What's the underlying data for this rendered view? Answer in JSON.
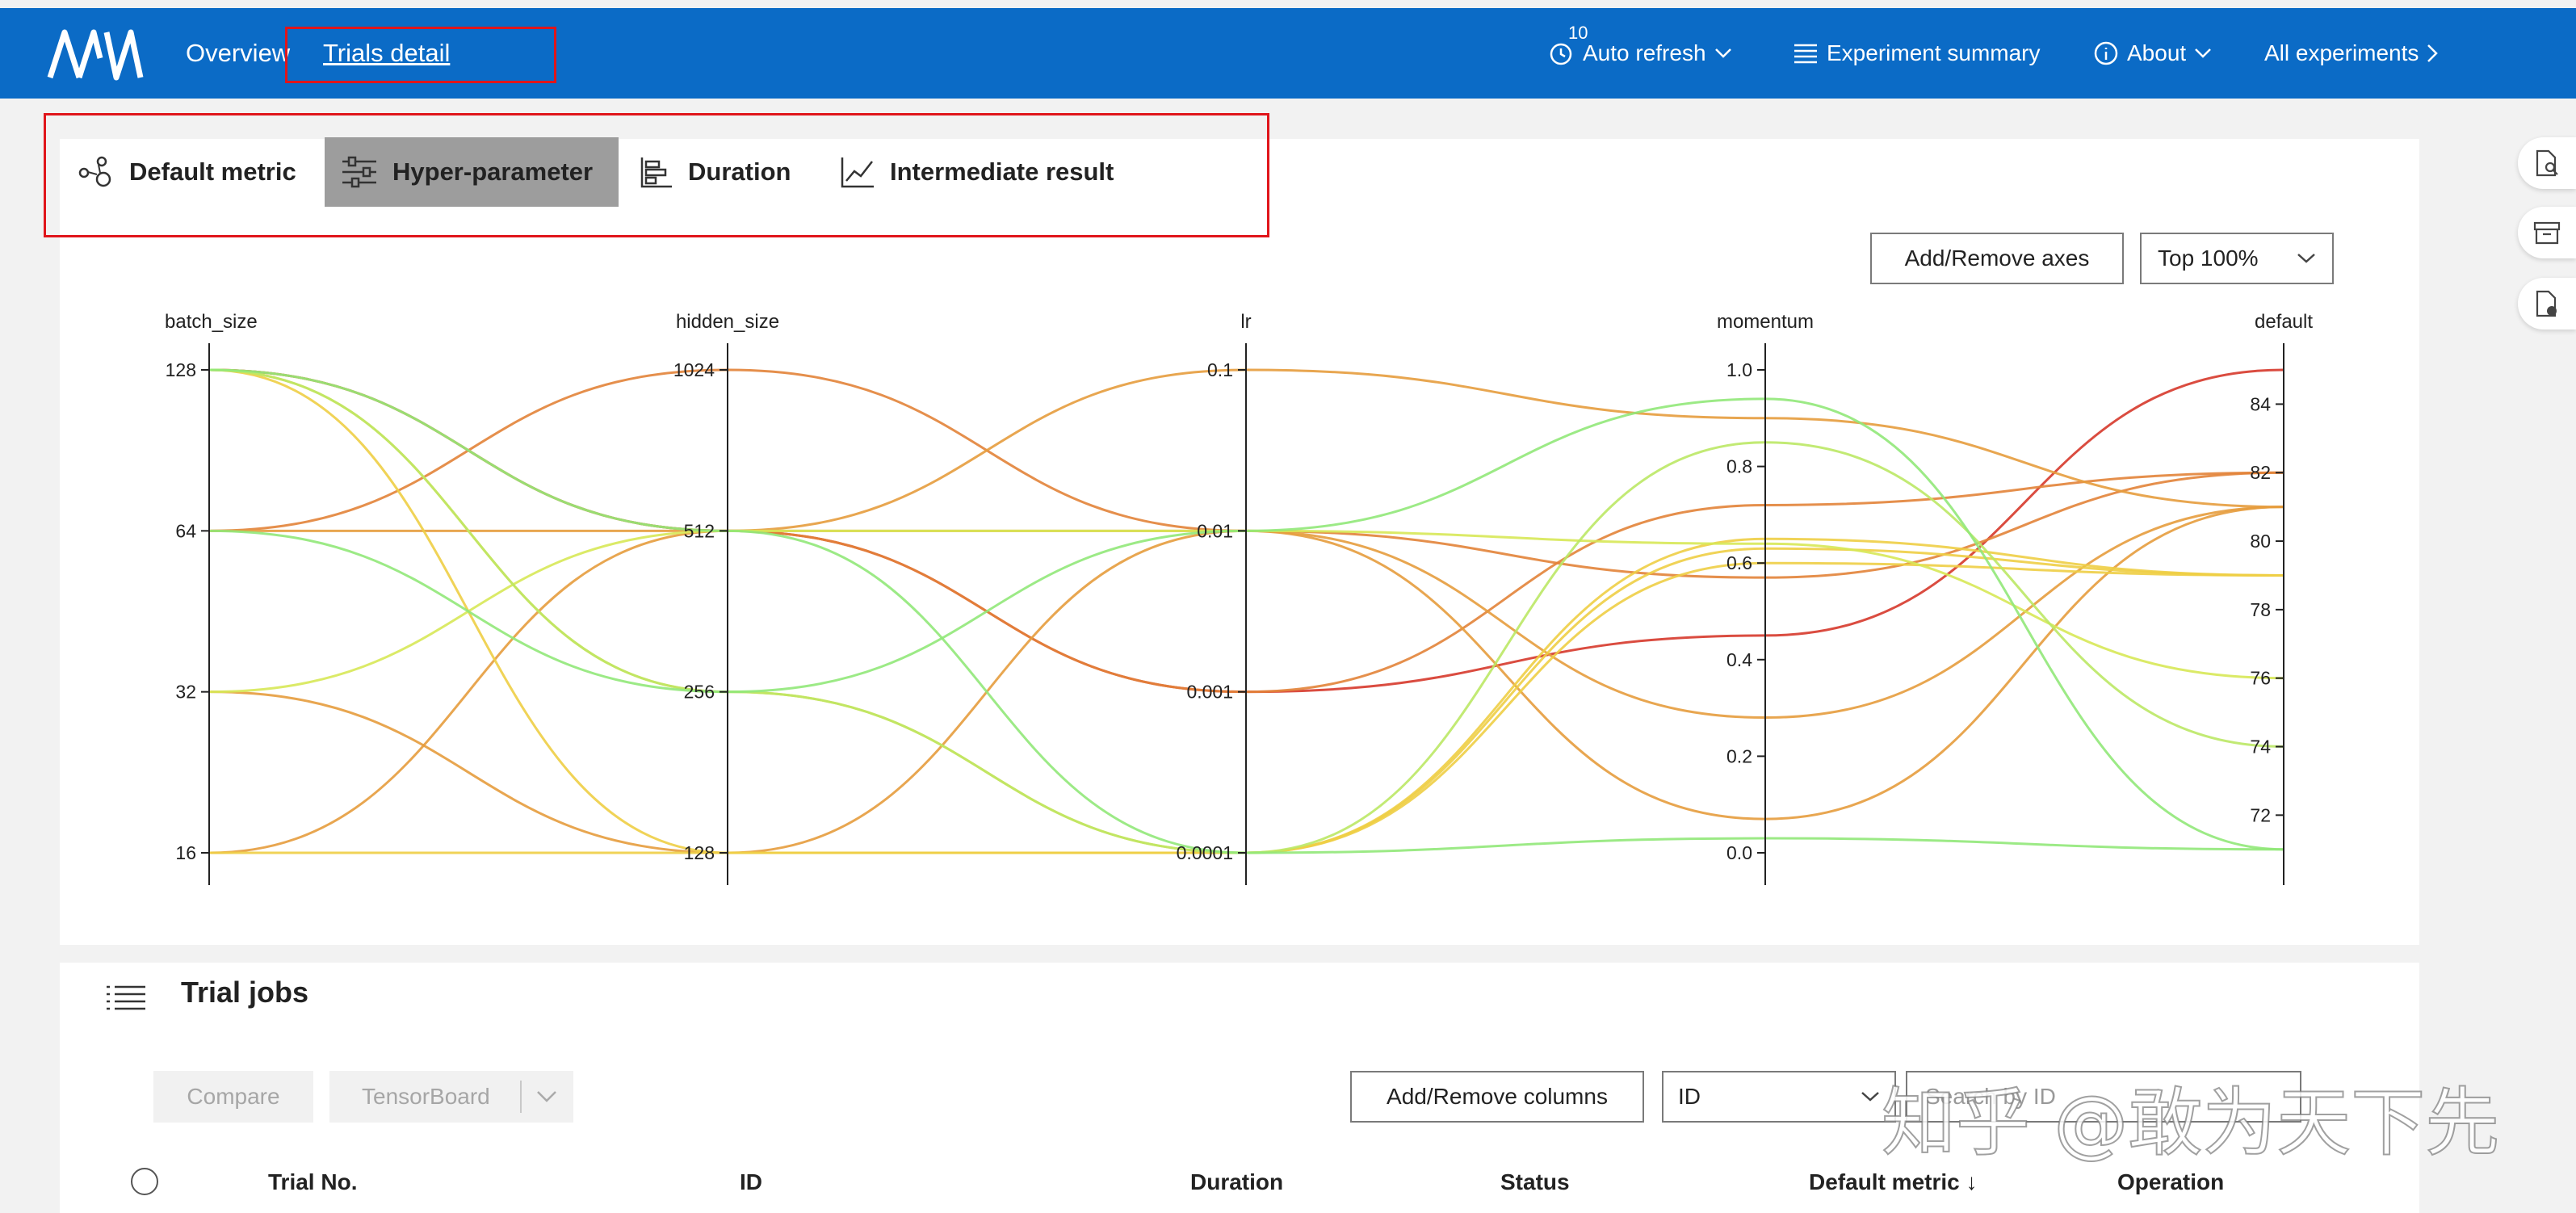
{
  "header": {
    "logo_icon": "nni-logo-icon",
    "nav": [
      {
        "label": "Overview"
      },
      {
        "label": "Trials detail"
      }
    ],
    "auto_refresh": {
      "label": "Auto refresh",
      "count": "10"
    },
    "experiment_summary": "Experiment summary",
    "about": "About",
    "all_experiments": "All experiments"
  },
  "tabs": [
    {
      "label": "Default metric",
      "icon": "scatter-icon"
    },
    {
      "label": "Hyper-parameter",
      "icon": "sliders-icon",
      "selected": true
    },
    {
      "label": "Duration",
      "icon": "bar-list-icon"
    },
    {
      "label": "Intermediate result",
      "icon": "line-chart-icon"
    }
  ],
  "controls": {
    "add_remove_axes": "Add/Remove axes",
    "top_select": "Top 100%"
  },
  "chart_data": {
    "type": "parallel-coordinates",
    "axes": [
      {
        "name": "batch_size",
        "ticks": [
          "16",
          "32",
          "64",
          "128"
        ],
        "scale": "log2"
      },
      {
        "name": "hidden_size",
        "ticks": [
          "128",
          "256",
          "512",
          "1024"
        ],
        "scale": "log2"
      },
      {
        "name": "lr",
        "ticks": [
          "0.0001",
          "0.001",
          "0.01",
          "0.1"
        ],
        "scale": "log10"
      },
      {
        "name": "momentum",
        "ticks": [
          "0.0",
          "0.2",
          "0.4",
          "0.6",
          "0.8",
          "1.0"
        ],
        "range": [
          0,
          1
        ],
        "scale": "linear"
      },
      {
        "name": "default",
        "ticks": [
          "72",
          "74",
          "76",
          "78",
          "80",
          "82",
          "84"
        ],
        "range": [
          70.9,
          85.0
        ],
        "scale": "linear"
      }
    ],
    "color_scale": {
      "low": "#90e87a",
      "mid": "#f2e84a",
      "high": "#d6392b"
    },
    "trials": [
      {
        "batch_size": 128,
        "hidden_size": 512,
        "lr": 0.001,
        "momentum": 0.45,
        "default": 85.0
      },
      {
        "batch_size": 128,
        "hidden_size": 512,
        "lr": 0.001,
        "momentum": 0.72,
        "default": 82.0
      },
      {
        "batch_size": 64,
        "hidden_size": 1024,
        "lr": 0.01,
        "momentum": 0.57,
        "default": 82.0
      },
      {
        "batch_size": 64,
        "hidden_size": 512,
        "lr": 0.1,
        "momentum": 0.9,
        "default": 81.0
      },
      {
        "batch_size": 16,
        "hidden_size": 512,
        "lr": 0.01,
        "momentum": 0.28,
        "default": 81.0
      },
      {
        "batch_size": 32,
        "hidden_size": 128,
        "lr": 0.01,
        "momentum": 0.07,
        "default": 81.0
      },
      {
        "batch_size": 128,
        "hidden_size": 128,
        "lr": 0.0001,
        "momentum": 0.65,
        "default": 79.0
      },
      {
        "batch_size": 16,
        "hidden_size": 128,
        "lr": 0.0001,
        "momentum": 0.63,
        "default": 79.0
      },
      {
        "batch_size": 128,
        "hidden_size": 256,
        "lr": 0.0001,
        "momentum": 0.6,
        "default": 79.0
      },
      {
        "batch_size": 32,
        "hidden_size": 512,
        "lr": 0.01,
        "momentum": 0.64,
        "default": 76.0
      },
      {
        "batch_size": 128,
        "hidden_size": 256,
        "lr": 0.0001,
        "momentum": 0.85,
        "default": 74.0
      },
      {
        "batch_size": 64,
        "hidden_size": 256,
        "lr": 0.01,
        "momentum": 0.94,
        "default": 71.0
      },
      {
        "batch_size": 128,
        "hidden_size": 512,
        "lr": 0.0001,
        "momentum": 0.03,
        "default": 71.0
      }
    ]
  },
  "side_icons": [
    "document-search-icon",
    "archive-icon",
    "document-status-icon"
  ],
  "trial_jobs": {
    "title": "Trial jobs",
    "compare": "Compare",
    "tensorboard": "TensorBoard",
    "add_remove_columns": "Add/Remove columns",
    "search_field": "ID",
    "search_placeholder": "Search by ID",
    "columns": [
      "Trial No.",
      "ID",
      "Duration",
      "Status",
      "Default metric ↓",
      "Operation"
    ]
  },
  "watermark": "知乎 @敢为天下先"
}
